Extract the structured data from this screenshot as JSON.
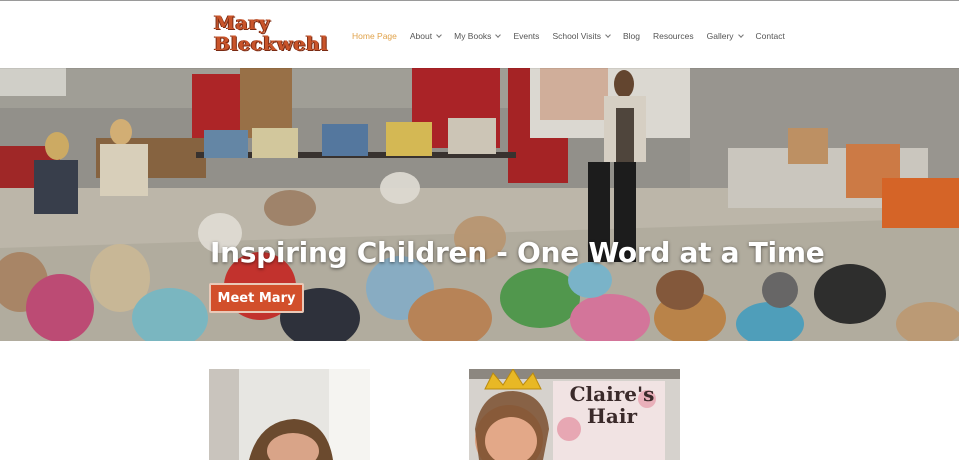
{
  "site": {
    "logo_line1": "Mary",
    "logo_line2": "Bleckwehl"
  },
  "nav": {
    "items": [
      {
        "label": "Home Page",
        "active": true,
        "has_dropdown": false
      },
      {
        "label": "About",
        "active": false,
        "has_dropdown": true
      },
      {
        "label": "My Books",
        "active": false,
        "has_dropdown": true
      },
      {
        "label": "Events",
        "active": false,
        "has_dropdown": false
      },
      {
        "label": "School Visits",
        "active": false,
        "has_dropdown": true
      },
      {
        "label": "Blog",
        "active": false,
        "has_dropdown": false
      },
      {
        "label": "Resources",
        "active": false,
        "has_dropdown": false
      },
      {
        "label": "Gallery",
        "active": false,
        "has_dropdown": true
      },
      {
        "label": "Contact",
        "active": false,
        "has_dropdown": false
      }
    ]
  },
  "hero": {
    "title": "Inspiring Children - One Word at a Time",
    "button_label": "Meet Mary"
  },
  "book_sign": {
    "line1": "Claire's",
    "line2": "Hair"
  },
  "colors": {
    "accent": "#e0a24a",
    "button": "#d24f2b",
    "logo": "#c9542a"
  }
}
